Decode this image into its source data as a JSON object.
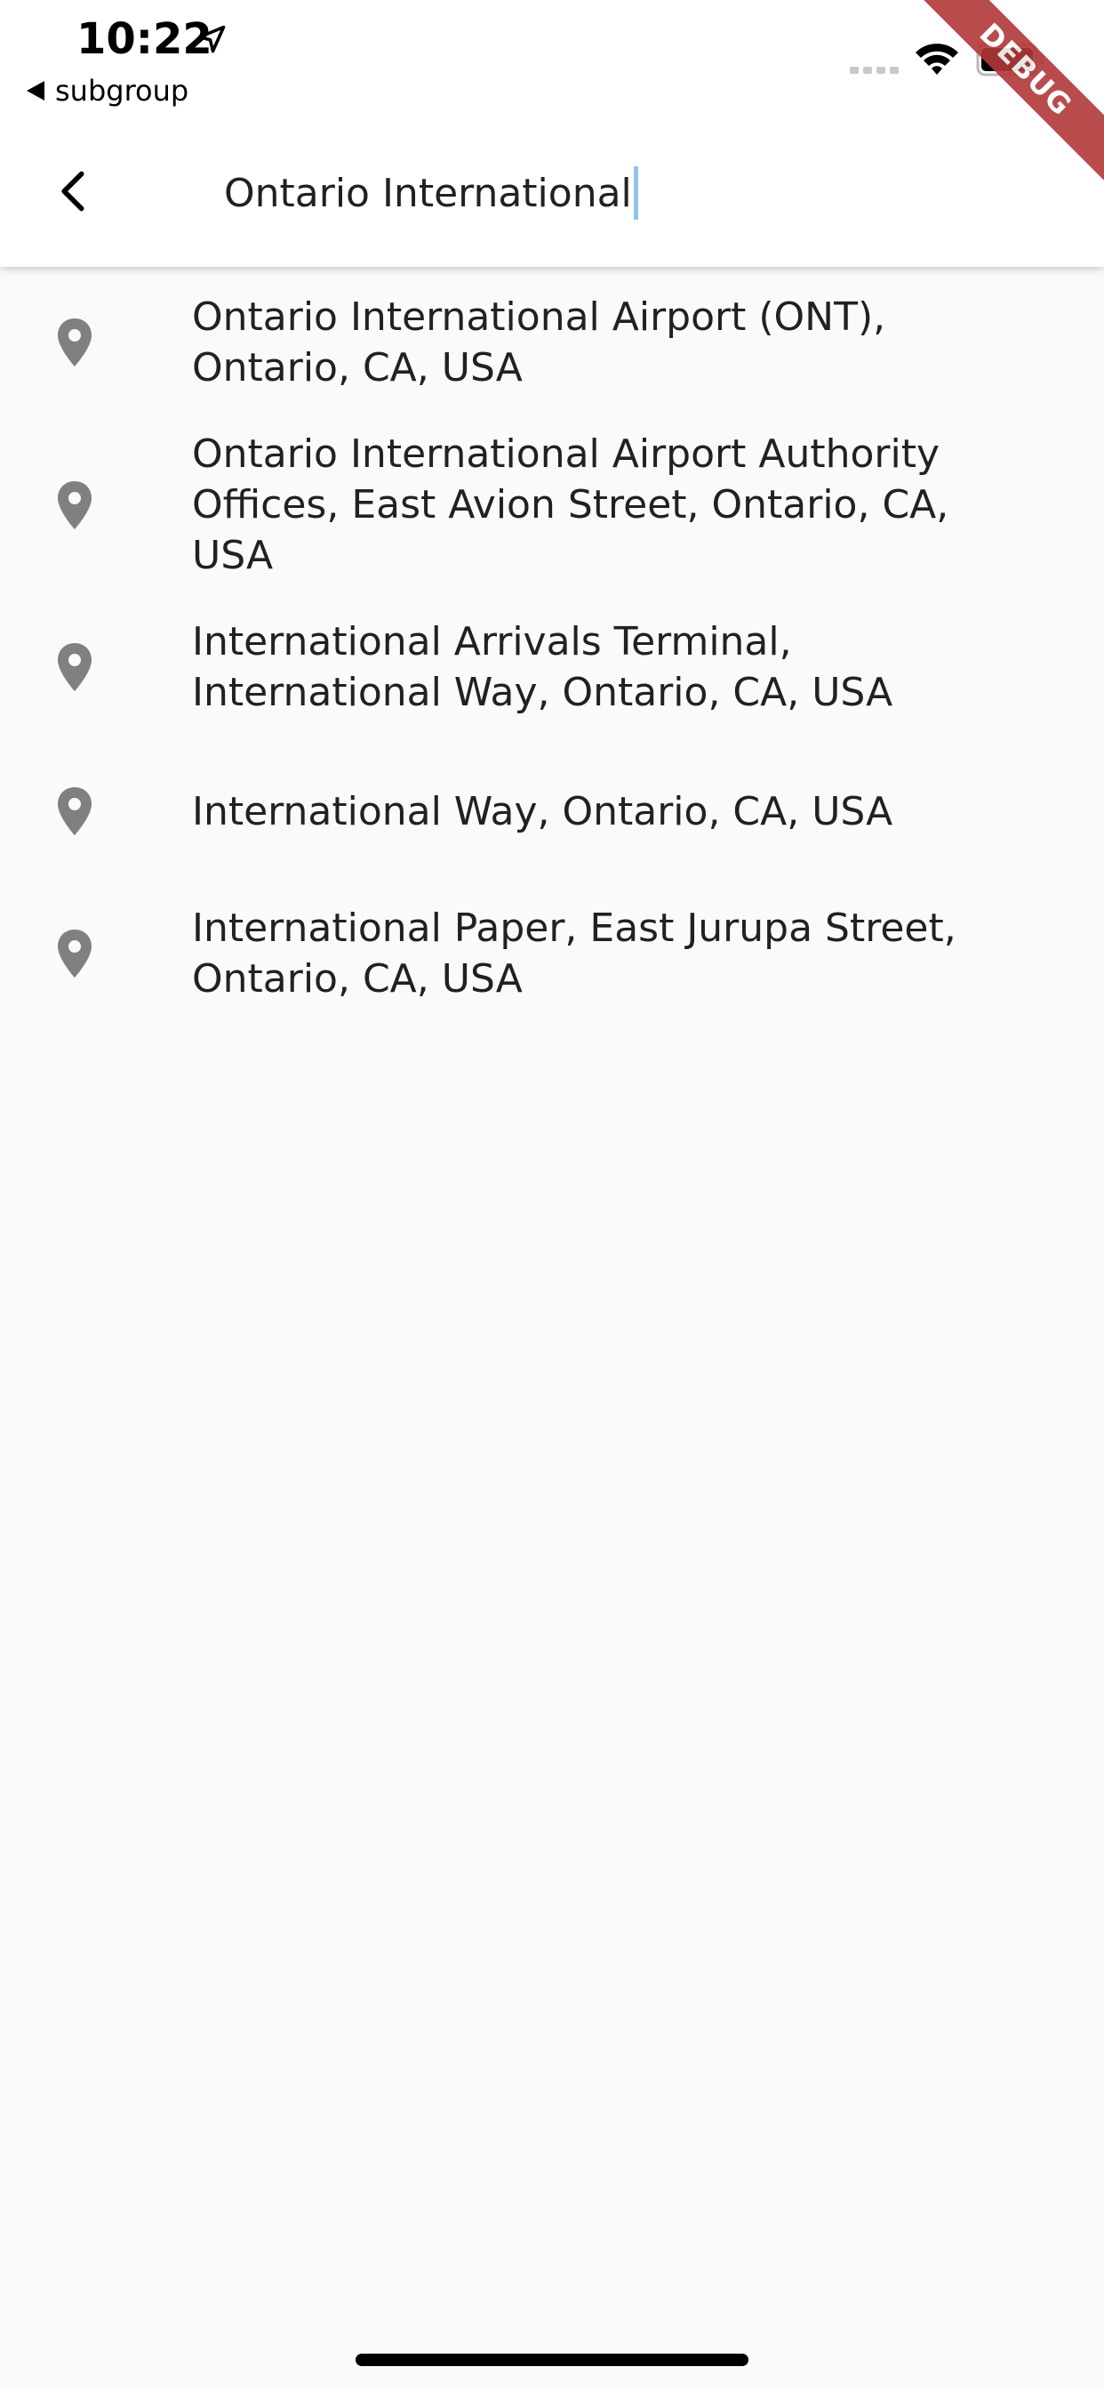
{
  "status_bar": {
    "time": "10:22",
    "back_app_label": "subgroup",
    "icons": [
      "location-arrow-icon",
      "signal-icon",
      "wifi-icon",
      "battery-icon"
    ]
  },
  "app_bar": {
    "back_icon": "chevron-left-icon",
    "search_value": "Ontario International",
    "cursor_color": "#90c2ef"
  },
  "results": [
    {
      "label": "Ontario International Airport (ONT), Ontario, CA, USA",
      "icon": "map-pin-icon"
    },
    {
      "label": "Ontario International Airport Authority Offices, East Avion Street, Ontario, CA, USA",
      "icon": "map-pin-icon"
    },
    {
      "label": "International Arrivals Terminal, International Way, Ontario, CA, USA",
      "icon": "map-pin-icon"
    },
    {
      "label": "International Way, Ontario, CA, USA",
      "icon": "map-pin-icon"
    },
    {
      "label": "International Paper, East Jurupa Street, Ontario, CA, USA",
      "icon": "map-pin-icon"
    }
  ],
  "debug_banner": {
    "label": "DEBUG",
    "color": "#b13939"
  },
  "colors": {
    "background": "#fafafa",
    "app_bar": "#ffffff",
    "pin_icon": "#808080",
    "text": "#212121"
  }
}
